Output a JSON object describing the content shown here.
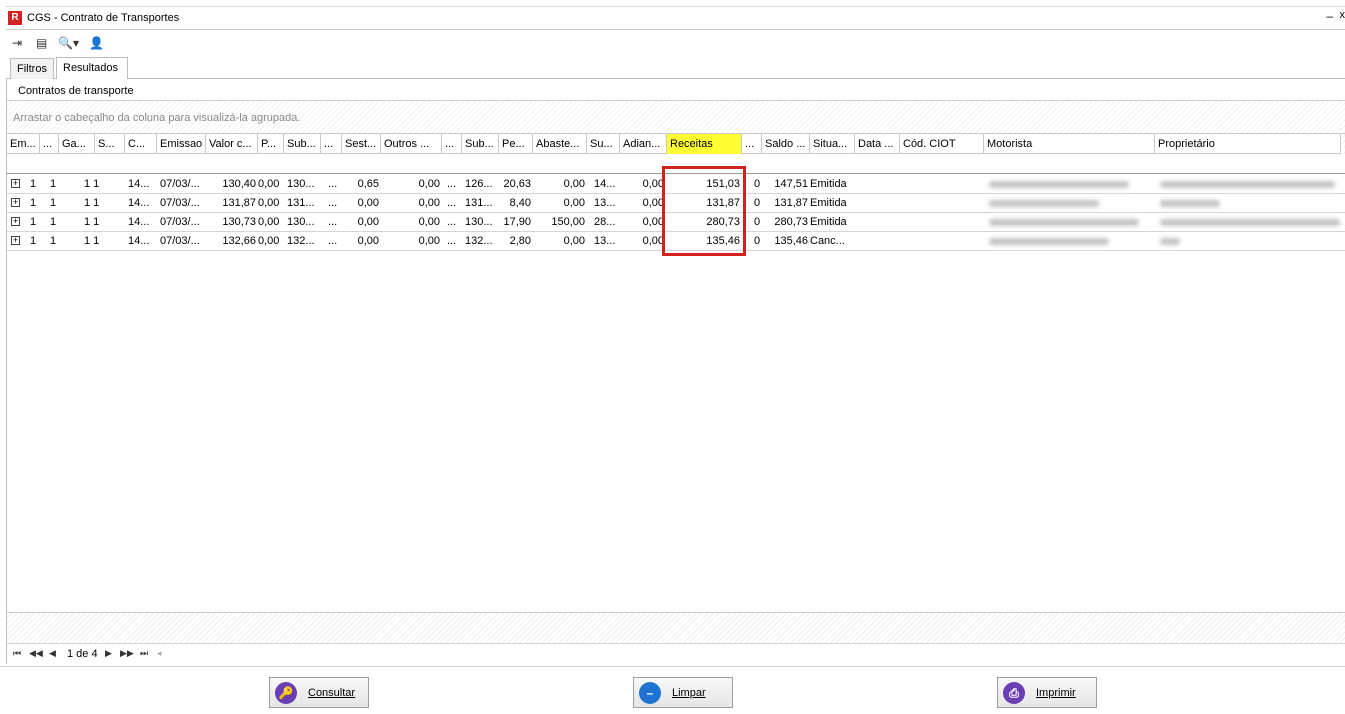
{
  "window": {
    "title": "CGS - Contrato de Transportes",
    "logo": "R",
    "min_glyph": "–",
    "close_glyph": "x"
  },
  "toolbar": [
    {
      "name": "export-icon",
      "glyph": "⇥"
    },
    {
      "name": "print-preview-icon",
      "glyph": "▤"
    },
    {
      "name": "search-icon",
      "glyph": "🔍▾"
    },
    {
      "name": "user-icon",
      "glyph": "👤"
    }
  ],
  "tabs": [
    "Filtros",
    "Resultados"
  ],
  "panel": {
    "title": "Contratos de transporte",
    "group_hint": "Arrastar o cabeçalho da coluna para visualizá-la agrupada."
  },
  "columns": [
    "Em...",
    "...",
    "Ga...",
    "S...",
    "C...",
    "Emissao",
    "Valor c...",
    "P...",
    "Sub...",
    "...",
    "Sest...",
    "Outros ...",
    "...",
    "Sub...",
    "Pe...",
    "Abaste...",
    "Su...",
    "Adian...",
    "Receitas",
    "...",
    "Saldo ...",
    "Situa...",
    "Data ...",
    "Cód. CIOT",
    "Motorista",
    "Proprietário"
  ],
  "highlight_column": "Receitas",
  "rows": [
    {
      "expander": "+",
      "c0": "1",
      "c1": "1",
      "c2": "1 1",
      "c3": "14...",
      "emissao": "07/03/...",
      "valor": "130,40",
      "p": "0,00",
      "sub": "130...",
      "dots": "...",
      "sest": "0,65",
      "outros": "0,00",
      "dots2": "...",
      "sub2": "126...",
      "pe": "20,63",
      "abaste": "0,00",
      "su": "14...",
      "adian": "0,00",
      "receitas": "151,03",
      "x": "0",
      "saldo": "147,51",
      "situacao": "Emitida"
    },
    {
      "expander": "+",
      "c0": "1",
      "c1": "1",
      "c2": "1 1",
      "c3": "14...",
      "emissao": "07/03/...",
      "valor": "131,87",
      "p": "0,00",
      "sub": "131...",
      "dots": "...",
      "sest": "0,00",
      "outros": "0,00",
      "dots2": "...",
      "sub2": "131...",
      "pe": "8,40",
      "abaste": "0,00",
      "su": "13...",
      "adian": "0,00",
      "receitas": "131,87",
      "x": "0",
      "saldo": "131,87",
      "situacao": "Emitida"
    },
    {
      "expander": "+",
      "c0": "1",
      "c1": "1",
      "c2": "1 1",
      "c3": "14...",
      "emissao": "07/03/...",
      "valor": "130,73",
      "p": "0,00",
      "sub": "130...",
      "dots": "...",
      "sest": "0,00",
      "outros": "0,00",
      "dots2": "...",
      "sub2": "130...",
      "pe": "17,90",
      "abaste": "150,00",
      "su": "28...",
      "adian": "0,00",
      "receitas": "280,73",
      "x": "0",
      "saldo": "280,73",
      "situacao": "Emitida"
    },
    {
      "expander": "+",
      "c0": "1",
      "c1": "1",
      "c2": "1 1",
      "c3": "14...",
      "emissao": "07/03/...",
      "valor": "132,66",
      "p": "0,00",
      "sub": "132...",
      "dots": "...",
      "sest": "0,00",
      "outros": "0,00",
      "dots2": "...",
      "sub2": "132...",
      "pe": "2,80",
      "abaste": "0,00",
      "su": "13...",
      "adian": "0,00",
      "receitas": "135,46",
      "x": "0",
      "saldo": "135,46",
      "situacao": "Canc..."
    }
  ],
  "pager": {
    "first": "⏮",
    "prev_page": "◀◀",
    "prev": "◀",
    "label": "1 de 4",
    "next": "▶",
    "next_page": "▶▶",
    "last": "⏭",
    "extra": "◂"
  },
  "buttons": {
    "consultar": {
      "label": "Consultar",
      "icon": "🔑",
      "color": "#6a3fb5"
    },
    "limpar": {
      "label": "Limpar",
      "icon": "–",
      "color": "#1f74d1"
    },
    "imprimir": {
      "label": "Imprimir",
      "icon": "⎙",
      "color": "#6a3fb5"
    }
  },
  "colors": {
    "highlight": "#ffff33",
    "annotation_box": "#d32020"
  }
}
